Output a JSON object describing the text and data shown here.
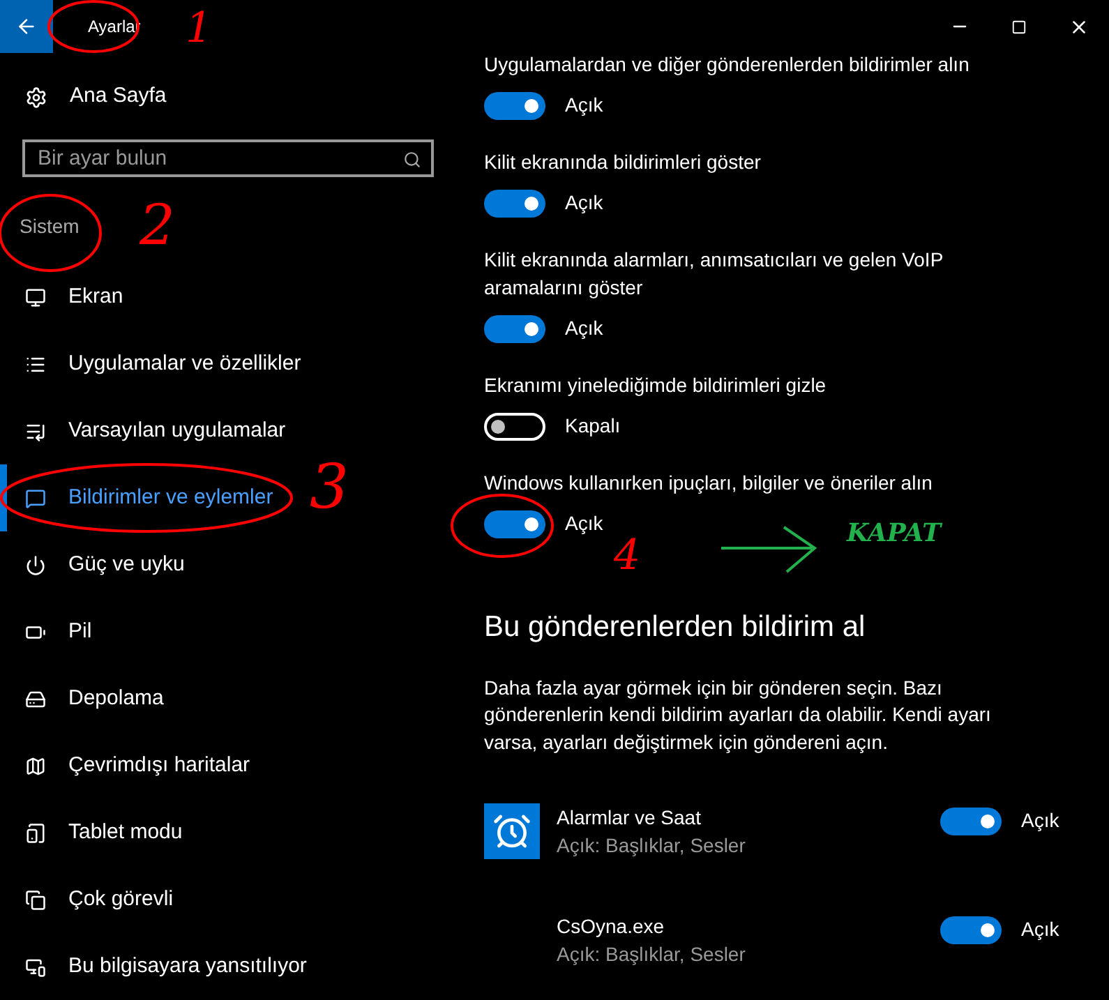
{
  "window": {
    "title": "Ayarlar"
  },
  "sidebar": {
    "home": "Ana Sayfa",
    "search": {
      "placeholder": "Bir ayar bulun"
    },
    "section": "Sistem",
    "items": [
      {
        "label": "Ekran",
        "selected": false
      },
      {
        "label": "Uygulamalar ve özellikler",
        "selected": false
      },
      {
        "label": "Varsayılan uygulamalar",
        "selected": false
      },
      {
        "label": "Bildirimler ve eylemler",
        "selected": true
      },
      {
        "label": "Güç ve uyku",
        "selected": false
      },
      {
        "label": "Pil",
        "selected": false
      },
      {
        "label": "Depolama",
        "selected": false
      },
      {
        "label": "Çevrimdışı haritalar",
        "selected": false
      },
      {
        "label": "Tablet modu",
        "selected": false
      },
      {
        "label": "Çok görevli",
        "selected": false
      },
      {
        "label": "Bu bilgisayara yansıtılıyor",
        "selected": false
      }
    ]
  },
  "settings": [
    {
      "label": "Uygulamalardan ve diğer gönderenlerden bildirimler alın",
      "on": true,
      "state": "Açık"
    },
    {
      "label": "Kilit ekranında bildirimleri göster",
      "on": true,
      "state": "Açık"
    },
    {
      "label": "Kilit ekranında alarmları, anımsatıcıları ve gelen VoIP aramalarını göster",
      "on": true,
      "state": "Açık"
    },
    {
      "label": "Ekranımı yinelediğimde bildirimleri gizle",
      "on": false,
      "state": "Kapalı"
    },
    {
      "label": "Windows kullanırken ipuçları, bilgiler ve öneriler alın",
      "on": true,
      "state": "Açık"
    }
  ],
  "senders": {
    "heading": "Bu gönderenlerden bildirim al",
    "description": "Daha fazla ayar görmek için bir gönderen seçin. Bazı gönderenlerin kendi bildirim ayarları da olabilir. Kendi ayarı varsa, ayarları değiştirmek için göndereni açın.",
    "apps": [
      {
        "name": "Alarmlar ve Saat",
        "detail": "Açık: Başlıklar, Sesler",
        "on": true,
        "state": "Açık",
        "has_icon": true
      },
      {
        "name": "CsOyna.exe",
        "detail": "Açık: Başlıklar, Sesler",
        "on": true,
        "state": "Açık",
        "has_icon": false
      }
    ]
  },
  "annotations": [
    {
      "text": "1",
      "color": "#ff0000"
    },
    {
      "text": "2",
      "color": "#ff0000"
    },
    {
      "text": "3",
      "color": "#ff0000"
    },
    {
      "text": "4",
      "color": "#ff0000"
    },
    {
      "text": "KAPAT",
      "color": "#22b14c"
    }
  ]
}
